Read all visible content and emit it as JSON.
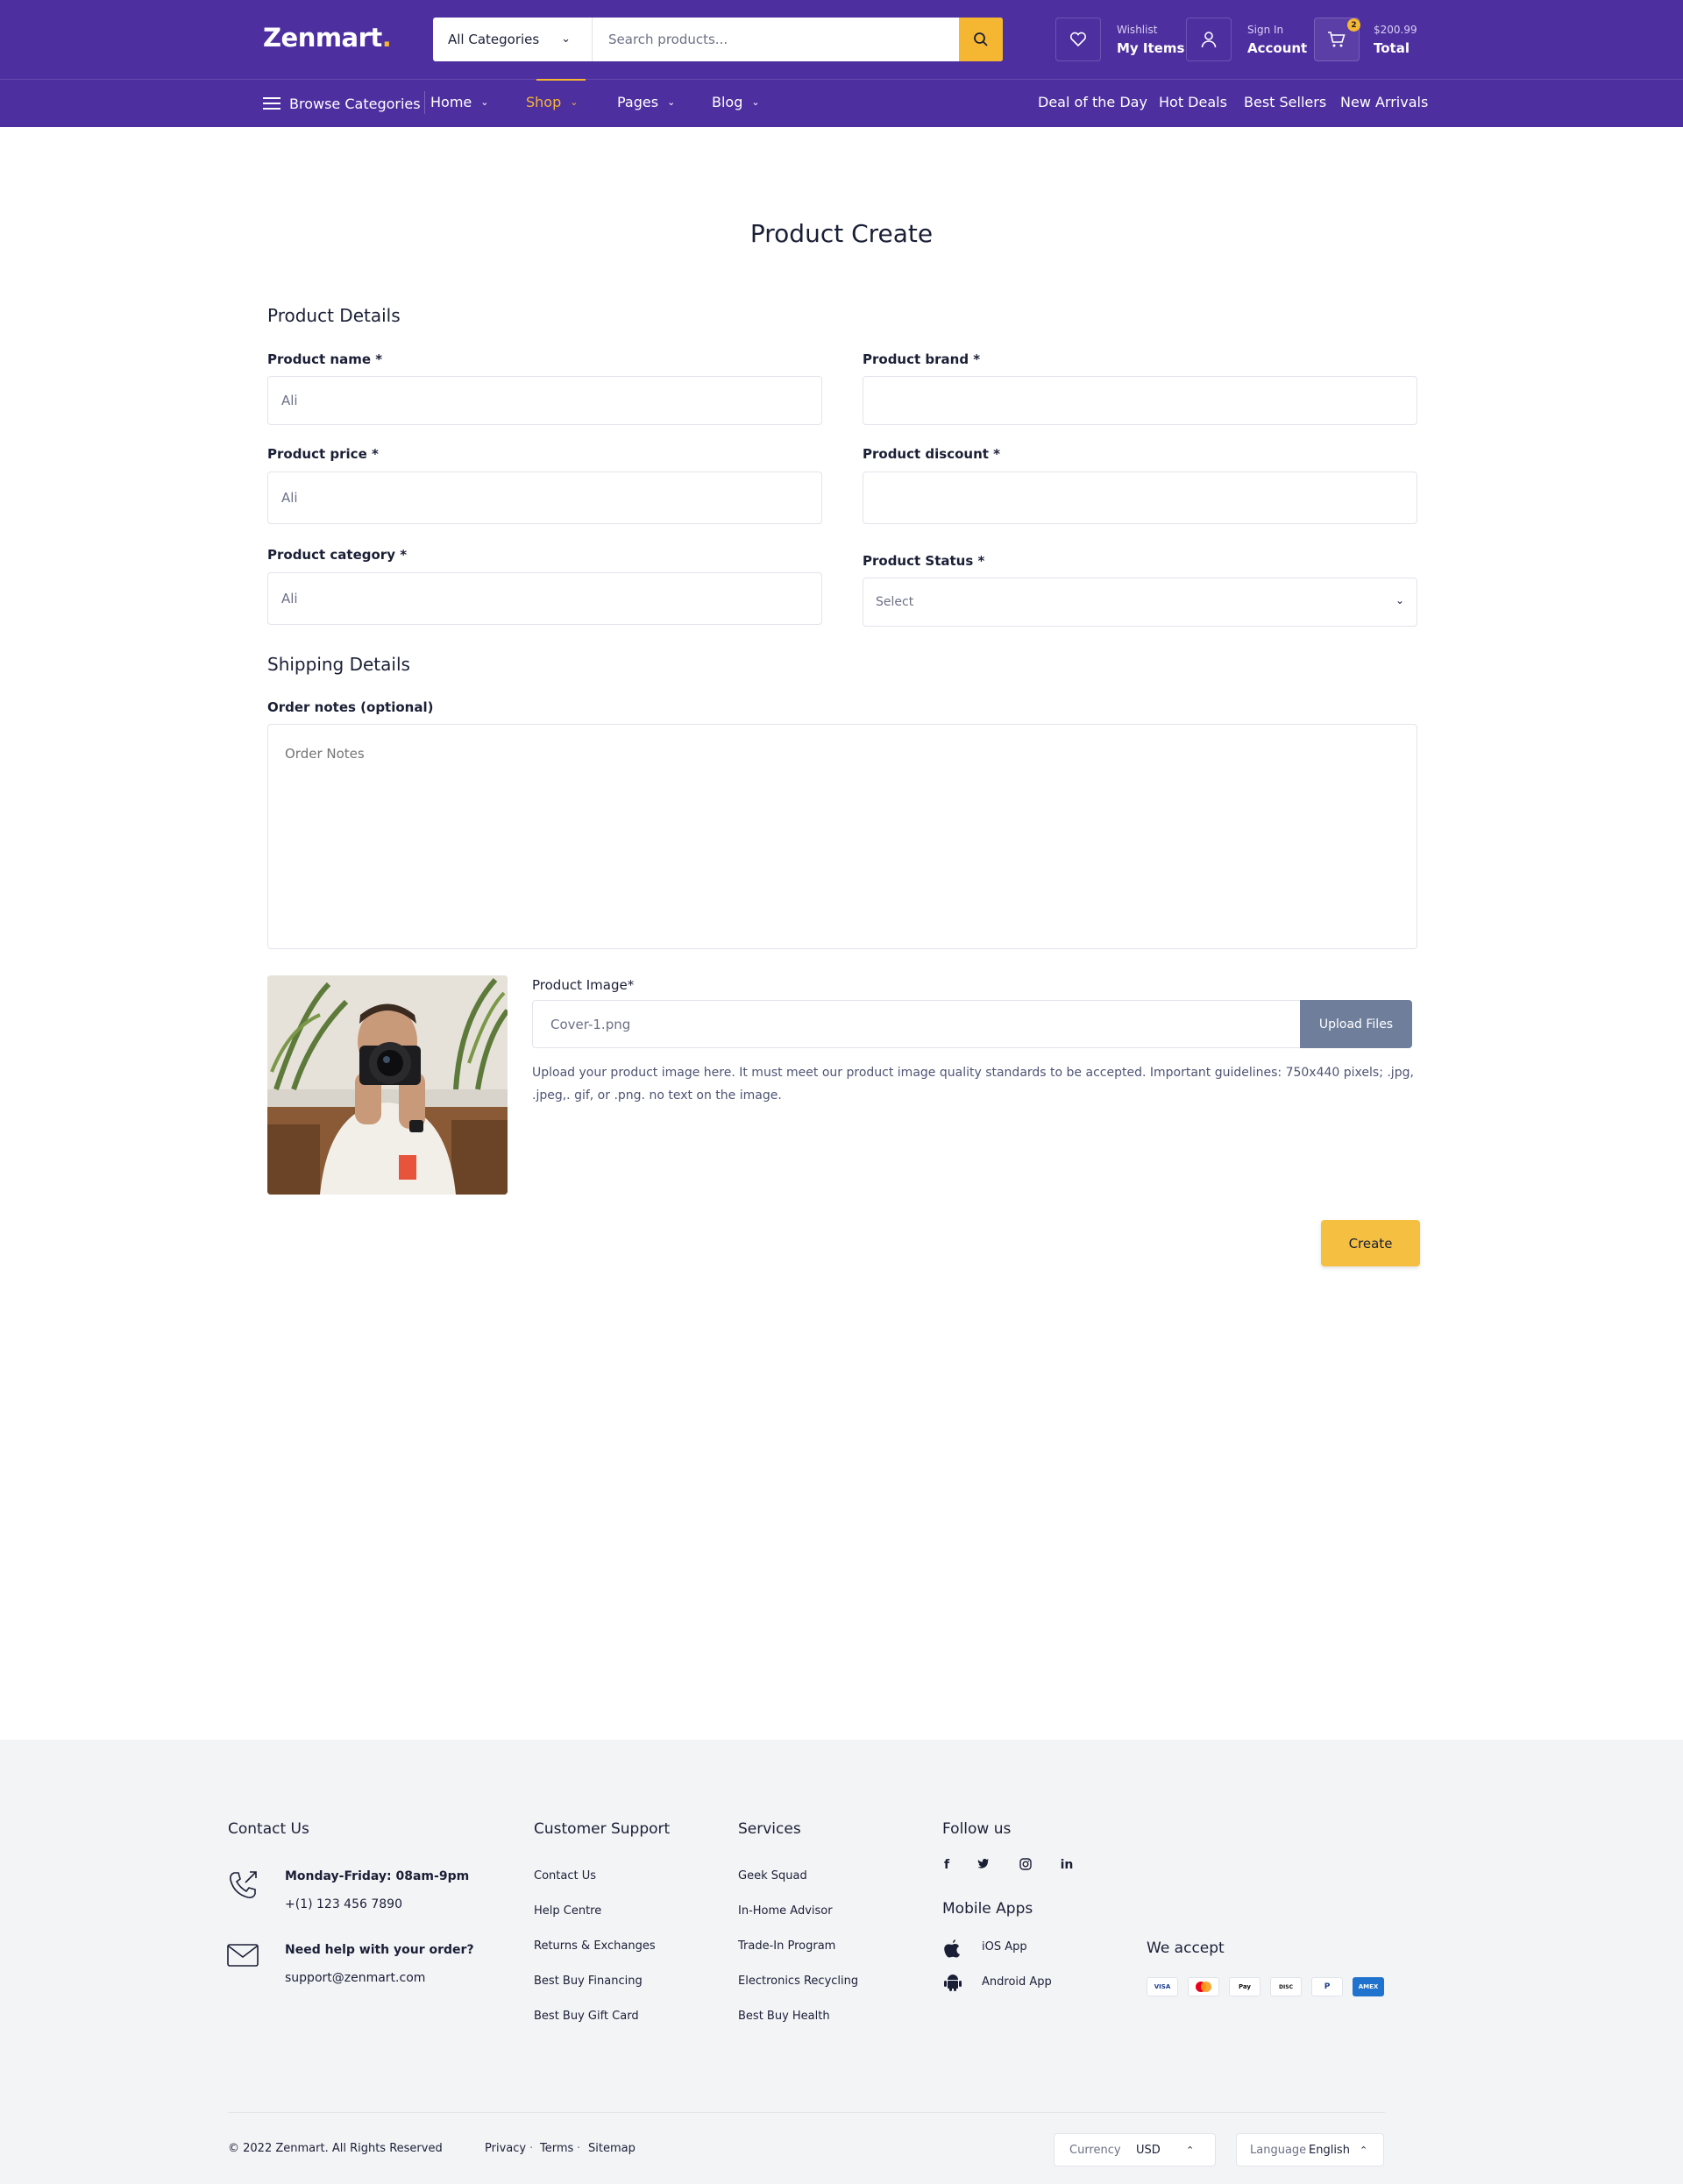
{
  "header": {
    "logo": "Zenmart",
    "logo_dot": ".",
    "category_select": "All Categories",
    "search_placeholder": "Search products...",
    "wishlist_small": "Wishlist",
    "wishlist_big": "My Items",
    "account_small": "Sign In",
    "account_big": "Account",
    "cart_count": "2",
    "cart_amount": "$200.99",
    "cart_label": "Total"
  },
  "nav": {
    "browse": "Browse Categories",
    "items": [
      {
        "label": "Home"
      },
      {
        "label": "Shop"
      },
      {
        "label": "Pages"
      },
      {
        "label": "Blog"
      }
    ],
    "right": [
      "Deal of the Day",
      "Hot Deals",
      "Best Sellers",
      "New Arrivals"
    ]
  },
  "form": {
    "title": "Product Create",
    "product_details": "Product Details",
    "name_label": "Product name *",
    "name_placeholder": "Ali",
    "brand_label": "Product brand *",
    "price_label": "Product price *",
    "price_placeholder": "Ali",
    "discount_label": "Product discount *",
    "category_label": "Product category *",
    "category_placeholder": "Ali",
    "status_label": "Product Status *",
    "status_value": "Select",
    "shipping_details": "Shipping Details",
    "notes_label": "Order notes (optional)",
    "notes_placeholder": "Order Notes",
    "image_label": "Product Image*",
    "image_file": "Cover-1.png",
    "upload_button": "Upload Files",
    "image_help": "Upload your product image here. It must meet our product image quality standards to be accepted. Important guidelines: 750x440 pixels; .jpg, .jpeg,. gif, or .png. no text on the image.",
    "create_button": "Create"
  },
  "footer": {
    "contact_title": "Contact Us",
    "hours": "Monday-Friday: 08am-9pm",
    "phone": "+(1) 123 456 7890",
    "help_title": "Need help with your order?",
    "email": "support@zenmart.com",
    "support_title": "Customer Support",
    "support_links": [
      "Contact Us",
      "Help Centre",
      "Returns & Exchanges",
      "Best Buy Financing",
      "Best Buy Gift Card"
    ],
    "services_title": "Services",
    "services_links": [
      "Geek Squad",
      "In-Home Advisor",
      "Trade-In Program",
      "Electronics Recycling",
      "Best Buy Health"
    ],
    "follow_title": "Follow us",
    "social": [
      "f",
      "t",
      "ig",
      "in"
    ],
    "apps_title": "Mobile Apps",
    "ios": "iOS App",
    "android": "Android App",
    "accept_title": "We accept",
    "cards": [
      "VISA",
      "MC",
      "Pay",
      "DISC",
      "P",
      "AMEX"
    ],
    "copyright": "© 2022 Zenmart. All Rights Reserved",
    "privacy": "Privacy",
    "terms": "Terms",
    "sitemap": "Sitemap",
    "currency_label": "Currency",
    "currency_value": "USD",
    "language_label": "Language",
    "language_value": "English"
  },
  "colors": {
    "brand": "#4e2fa0",
    "accent": "#f5b731",
    "upload_button": "#6f7f9b"
  }
}
